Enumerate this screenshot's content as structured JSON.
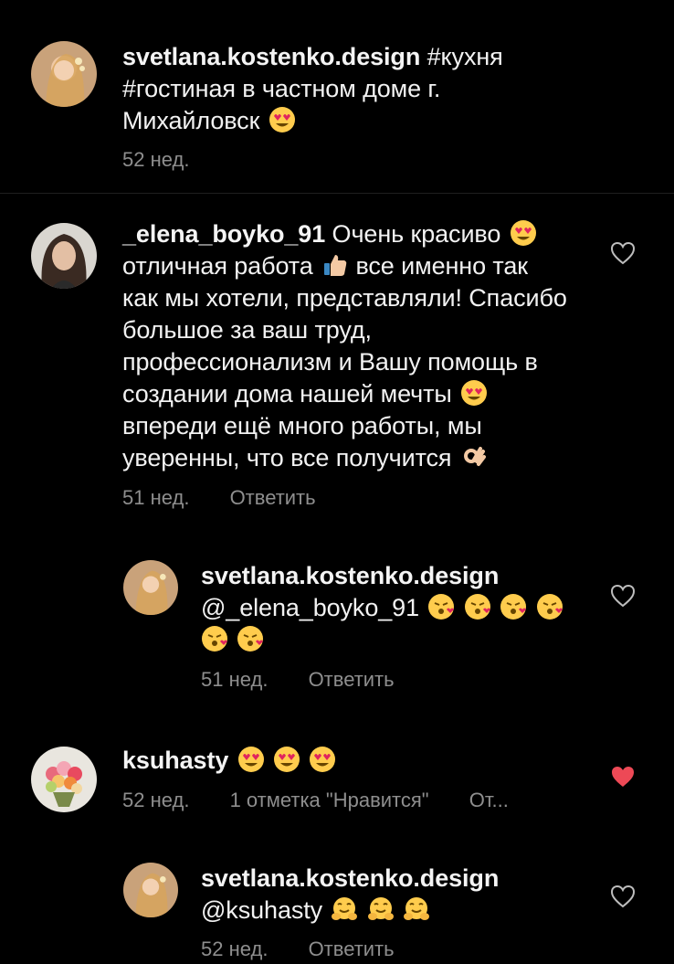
{
  "comments": [
    {
      "username": "svetlana.kostenko.design",
      "text_before": "#кухня #гостиная в частном доме г. Михайловск",
      "emojis": [
        "heart-eyes"
      ],
      "time": "52 нед.",
      "reply": "",
      "likes": ""
    },
    {
      "username": "_elena_boyko_91",
      "text_part1": "Очень красиво",
      "text_part2": "отличная работа",
      "text_part3": "все именно так как мы хотели, представляли! Спасибо большое за ваш труд, профессионализм и Вашу помощь в создании дома нашей мечты",
      "text_part4": "впереди ещё много работы, мы уверенны, что все получится",
      "time": "51 нед.",
      "reply": "Ответить",
      "liked": false
    },
    {
      "username": "svetlana.kostenko.design",
      "mention": "@_elena_boyko_91",
      "emojis": [
        "kiss",
        "kiss",
        "kiss",
        "kiss",
        "kiss",
        "kiss"
      ],
      "time": "51 нед.",
      "reply": "Ответить",
      "liked": false
    },
    {
      "username": "ksuhasty",
      "emojis": [
        "heart-eyes",
        "heart-eyes",
        "heart-eyes"
      ],
      "time": "52 нед.",
      "likes": "1 отметка \"Нравится\"",
      "reply": "От...",
      "liked": true
    },
    {
      "username": "svetlana.kostenko.design",
      "mention": "@ksuhasty",
      "emojis": [
        "hug",
        "hug",
        "hug"
      ],
      "time": "52 нед.",
      "reply": "Ответить",
      "liked": false
    }
  ],
  "colors": {
    "background": "#000000",
    "text": "#f2f2f2",
    "muted": "#8e8e8e",
    "like_active": "#ed4956"
  }
}
